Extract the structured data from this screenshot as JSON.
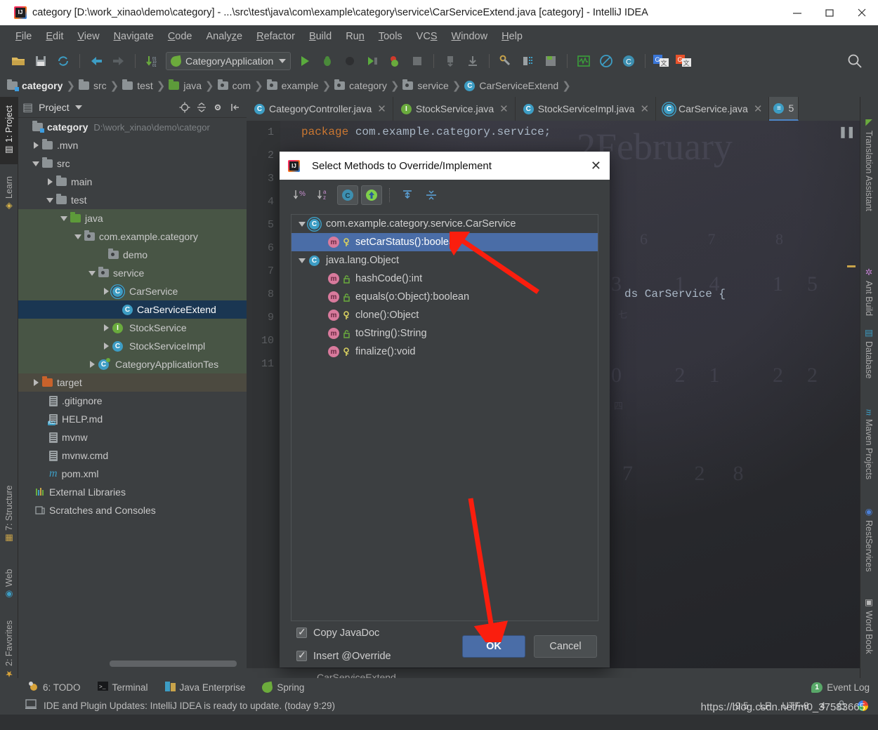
{
  "window": {
    "title": "category [D:\\work_xinao\\demo\\category] - ...\\src\\test\\java\\com\\example\\category\\service\\CarServiceExtend.java [category] - IntelliJ IDEA",
    "app_icon": "intellij-idea-logo",
    "minimize": "minimize-icon",
    "maximize": "maximize-icon",
    "close": "close-icon"
  },
  "menubar": {
    "items": [
      {
        "label": "File",
        "mnemonic": "F"
      },
      {
        "label": "Edit",
        "mnemonic": "E"
      },
      {
        "label": "View",
        "mnemonic": "V"
      },
      {
        "label": "Navigate",
        "mnemonic": "N"
      },
      {
        "label": "Code",
        "mnemonic": "C"
      },
      {
        "label": "Analyze",
        "mnemonic": "z"
      },
      {
        "label": "Refactor",
        "mnemonic": "R"
      },
      {
        "label": "Build",
        "mnemonic": "B"
      },
      {
        "label": "Run",
        "mnemonic": "n"
      },
      {
        "label": "Tools",
        "mnemonic": "T"
      },
      {
        "label": "VCS",
        "mnemonic": "S"
      },
      {
        "label": "Window",
        "mnemonic": "W"
      },
      {
        "label": "Help",
        "mnemonic": "H"
      }
    ]
  },
  "toolbar": {
    "run_config": "CategoryApplication",
    "icons": [
      "open-folder-icon",
      "save-all-icon",
      "sync-refresh-icon",
      "back-arrow-icon",
      "forward-arrow-icon",
      "compile-icon",
      "run-icon",
      "debug-icon",
      "run-with-coverage-icon",
      "profile-icon",
      "stop-icon",
      "attach-debugger-icon",
      "update-project-icon",
      "commit-icon",
      "settings-icon",
      "project-structure-icon",
      "save-icon",
      "monitor-icon",
      "no-entry-icon",
      "ide-scripting-icon",
      "translate-blue-icon",
      "translate-red-icon",
      "search-everywhere-icon"
    ]
  },
  "breadcrumb": {
    "items": [
      {
        "label": "category",
        "icon": "module-folder-icon"
      },
      {
        "label": "src",
        "icon": "folder-icon"
      },
      {
        "label": "test",
        "icon": "folder-icon"
      },
      {
        "label": "java",
        "icon": "source-folder-icon"
      },
      {
        "label": "com",
        "icon": "package-icon"
      },
      {
        "label": "example",
        "icon": "package-icon"
      },
      {
        "label": "category",
        "icon": "package-icon"
      },
      {
        "label": "service",
        "icon": "package-icon"
      },
      {
        "label": "CarServiceExtend",
        "icon": "class-icon"
      }
    ]
  },
  "left_tool_strip": {
    "tabs": [
      {
        "label": "1: Project",
        "icon": "project-icon",
        "selected": true
      },
      {
        "label": "Learn",
        "icon": "learn-icon",
        "selected": false
      },
      {
        "label": "7: Structure",
        "icon": "structure-icon",
        "selected": false
      },
      {
        "label": "Web",
        "icon": "web-icon",
        "selected": false
      },
      {
        "label": "2: Favorites",
        "icon": "star-icon",
        "selected": false
      }
    ]
  },
  "right_tool_strip": {
    "tabs": [
      {
        "label": "Translation Assistant",
        "icon": "translation-icon"
      },
      {
        "label": "Ant Build",
        "icon": "ant-icon"
      },
      {
        "label": "Database",
        "icon": "database-icon"
      },
      {
        "label": "Maven Projects",
        "icon": "maven-icon"
      },
      {
        "label": "RestServices",
        "icon": "rest-services-icon"
      },
      {
        "label": "Word Book",
        "icon": "word-book-icon"
      }
    ]
  },
  "project_panel": {
    "title": "Project",
    "actions": [
      "locate-icon",
      "collapse-all-icon",
      "settings-gear-icon",
      "hide-panel-icon"
    ],
    "tree": [
      {
        "label": "category",
        "path": "D:\\work_xinao\\demo\\categor",
        "indent": 0,
        "twisty": "none",
        "icon": "module-folder-icon",
        "bold": true,
        "highlight": "none"
      },
      {
        "label": ".mvn",
        "indent": 1,
        "twisty": "right",
        "icon": "folder-icon",
        "highlight": "none"
      },
      {
        "label": "src",
        "indent": 1,
        "twisty": "down",
        "icon": "folder-icon",
        "highlight": "none"
      },
      {
        "label": "main",
        "indent": 2,
        "twisty": "right",
        "icon": "folder-icon",
        "highlight": "none"
      },
      {
        "label": "test",
        "indent": 2,
        "twisty": "down",
        "icon": "folder-icon",
        "highlight": "none"
      },
      {
        "label": "java",
        "indent": 3,
        "twisty": "down",
        "icon": "source-folder-icon",
        "highlight": "green"
      },
      {
        "label": "com.example.category",
        "indent": 4,
        "twisty": "down",
        "icon": "package-icon",
        "highlight": "green"
      },
      {
        "label": "demo",
        "indent": 5,
        "twisty": "none",
        "icon": "package-icon",
        "highlight": "green"
      },
      {
        "label": "service",
        "indent": 5,
        "twisty": "down",
        "icon": "package-icon",
        "highlight": "green"
      },
      {
        "label": "CarService",
        "indent": 6,
        "twisty": "right",
        "icon": "abstract-class-icon",
        "highlight": "green"
      },
      {
        "label": "CarServiceExtend",
        "indent": 6,
        "twisty": "none",
        "icon": "class-icon",
        "highlight": "selected"
      },
      {
        "label": "StockService",
        "indent": 6,
        "twisty": "right",
        "icon": "interface-icon",
        "highlight": "green"
      },
      {
        "label": "StockServiceImpl",
        "indent": 6,
        "twisty": "right",
        "icon": "class-icon",
        "highlight": "green"
      },
      {
        "label": "CategoryApplicationTes",
        "indent": 5,
        "twisty": "right",
        "icon": "test-class-icon",
        "highlight": "green"
      },
      {
        "label": "target",
        "indent": 1,
        "twisty": "right",
        "icon": "target-folder-icon",
        "highlight": "tan"
      },
      {
        "label": ".gitignore",
        "indent": 2,
        "twisty": "none",
        "icon": "file-icon",
        "highlight": "none"
      },
      {
        "label": "HELP.md",
        "indent": 2,
        "twisty": "none",
        "icon": "markdown-file-icon",
        "highlight": "none"
      },
      {
        "label": "mvnw",
        "indent": 2,
        "twisty": "none",
        "icon": "file-icon",
        "highlight": "none"
      },
      {
        "label": "mvnw.cmd",
        "indent": 2,
        "twisty": "none",
        "icon": "file-icon",
        "highlight": "none"
      },
      {
        "label": "pom.xml",
        "indent": 2,
        "twisty": "none",
        "icon": "maven-file-icon",
        "highlight": "none"
      },
      {
        "label": "External Libraries",
        "indent": 1,
        "twisty": "none",
        "icon": "libraries-icon",
        "highlight": "none"
      },
      {
        "label": "Scratches and Consoles",
        "indent": 1,
        "twisty": "none",
        "icon": "scratches-icon",
        "highlight": "none"
      }
    ]
  },
  "editor": {
    "tabs": [
      {
        "label": "CategoryController.java",
        "icon": "class-icon",
        "active": false
      },
      {
        "label": "StockService.java",
        "icon": "interface-icon",
        "active": false
      },
      {
        "label": "StockServiceImpl.java",
        "icon": "class-icon",
        "active": false
      },
      {
        "label": "CarService.java",
        "icon": "abstract-class-icon",
        "active": false
      },
      {
        "label": "5",
        "icon": "more-tabs-icon",
        "active": true
      }
    ],
    "line_numbers": [
      "1",
      "2",
      "3",
      "4",
      "5",
      "6",
      "7",
      "8",
      "9",
      "10",
      "11"
    ],
    "code_line_1_keyword": "package",
    "code_line_1_rest": " com.example.category.service;",
    "code_line_8_fragment": "ds CarService {",
    "breadcrumb_bottom": "CarServiceExtend"
  },
  "dialog": {
    "title": "Select Methods to Override/Implement",
    "icon": "intellij-idea-logo",
    "close": "close-icon",
    "toolbar_buttons": [
      {
        "name": "sort-by-percent-icon",
        "active": false
      },
      {
        "name": "sort-alphabetically-icon",
        "active": false
      },
      {
        "name": "show-class-icon",
        "active": true
      },
      {
        "name": "show-implemented-icon",
        "active": true
      },
      {
        "name": "expand-all-icon",
        "active": false
      },
      {
        "name": "collapse-all-icon",
        "active": false
      }
    ],
    "groups": [
      {
        "label": "com.example.category.service.CarService",
        "icon": "abstract-class-icon",
        "twisty": "down",
        "methods": [
          {
            "label": "setCarStatus():boolean",
            "visibility": "public-key-icon",
            "selected": true
          }
        ]
      },
      {
        "label": "java.lang.Object",
        "icon": "class-icon",
        "twisty": "down",
        "methods": [
          {
            "label": "hashCode():int",
            "visibility": "protected-lock-icon",
            "selected": false
          },
          {
            "label": "equals(o:Object):boolean",
            "visibility": "protected-lock-icon",
            "selected": false
          },
          {
            "label": "clone():Object",
            "visibility": "public-key-icon",
            "selected": false
          },
          {
            "label": "toString():String",
            "visibility": "protected-lock-icon",
            "selected": false
          },
          {
            "label": "finalize():void",
            "visibility": "public-key-icon",
            "selected": false
          }
        ]
      }
    ],
    "checkbox_copy_javadoc": {
      "label": "Copy JavaDoc",
      "checked": true,
      "mnemonic": "J"
    },
    "checkbox_insert_override": {
      "label": "Insert @Override",
      "checked": true,
      "mnemonic": "O"
    },
    "ok_button": "OK",
    "cancel_button": "Cancel"
  },
  "bottom_bar": {
    "items": [
      {
        "label": "6: TODO",
        "icon": "todo-icon"
      },
      {
        "label": "Terminal",
        "icon": "terminal-icon"
      },
      {
        "label": "Java Enterprise",
        "icon": "java-enterprise-icon"
      },
      {
        "label": "Spring",
        "icon": "spring-leaf-icon"
      }
    ],
    "event_log": {
      "label": "Event Log",
      "badge": "1",
      "icon": "event-log-icon"
    }
  },
  "status_bar": {
    "message": "IDE and Plugin Updates: IntelliJ IDEA is ready to update. (today 9:29)",
    "icon": "notification-icon",
    "caret_position": "9:5",
    "line_separator": "LF",
    "encoding": "UTF-8",
    "indent": "4",
    "lock_icon": "lock-icon",
    "git_branch_icon": "branch-icon"
  },
  "watermark": {
    "text": "https://blog.csdn.net/m0_37583665"
  },
  "colors": {
    "accent_blue": "#4a6da7",
    "selection_blue": "#1a3652",
    "panel_bg": "#3c3f41",
    "editor_bg": "#2b2b2b",
    "green": "#6aab3d",
    "arrow_red": "#fa1e0e"
  }
}
